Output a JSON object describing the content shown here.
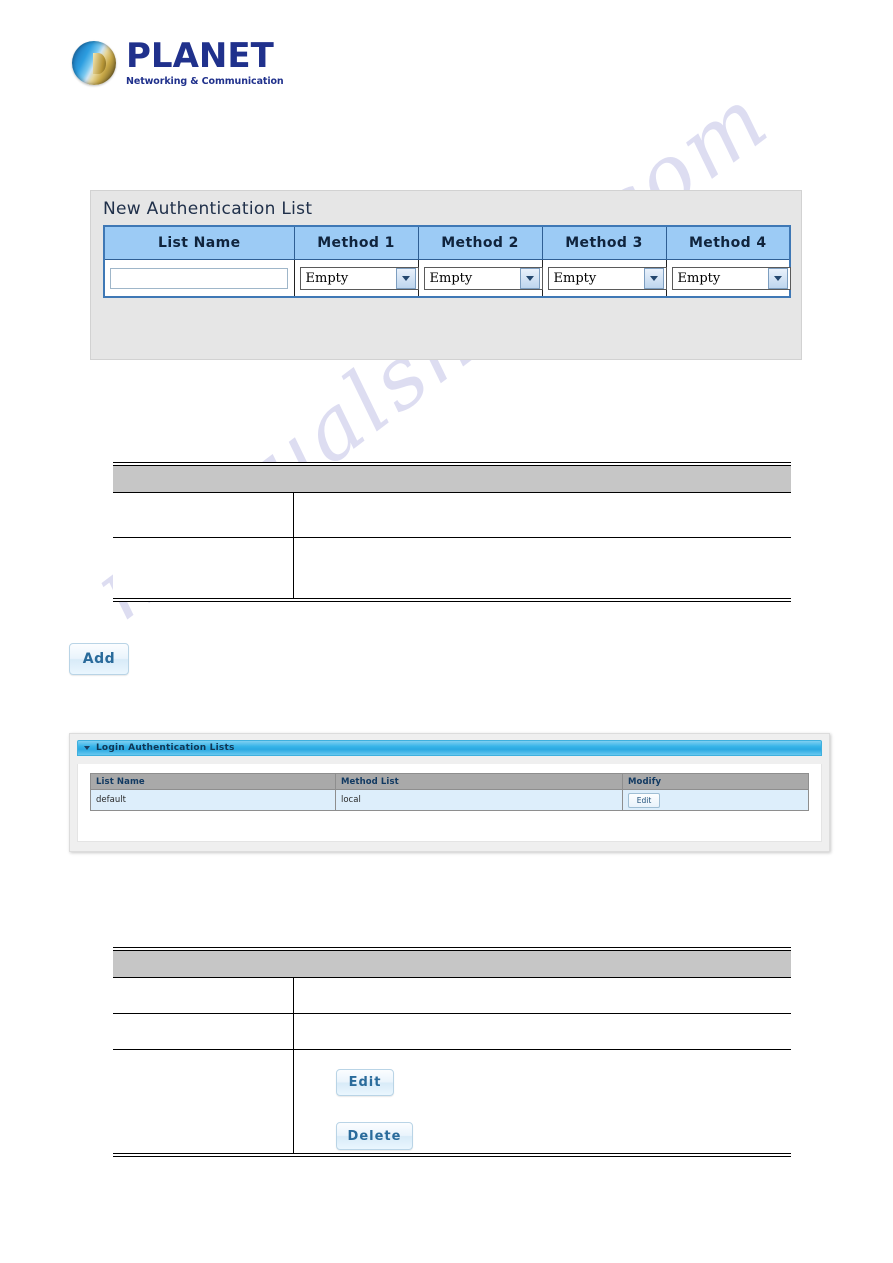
{
  "brand": {
    "name": "PLANET",
    "tagline": "Networking & Communication",
    "logo_icon": "planet-globe-icon",
    "name_color": "#20318c"
  },
  "watermark": {
    "text": "manualshive.com",
    "color": "#c9c9ea"
  },
  "new_auth_panel": {
    "title": "New Authentication List",
    "columns": [
      "List Name",
      "Method 1",
      "Method 2",
      "Method 3",
      "Method 4"
    ],
    "header_bg": "#9ccbf5",
    "border_color": "#3f78b5",
    "row": {
      "list_name_value": "",
      "list_name_placeholder": "",
      "method1": "Empty",
      "method2": "Empty",
      "method3": "Empty",
      "method4": "Empty"
    },
    "add_label": "Add",
    "dropdown_icon": "chevron-down-icon"
  },
  "standalone_buttons": {
    "add_label": "Add",
    "edit_label": "Edit",
    "delete_label": "Delete"
  },
  "doc_table_upper": {
    "columns": [
      "",
      ""
    ],
    "rows": [
      [
        "",
        ""
      ],
      [
        "",
        ""
      ]
    ]
  },
  "doc_table_lower": {
    "columns": [
      "",
      ""
    ],
    "rows": [
      [
        "",
        ""
      ],
      [
        "",
        ""
      ],
      [
        "",
        ""
      ]
    ]
  },
  "login_panel": {
    "header_title": "Login Authentication Lists",
    "collapse_icon": "chevron-down-icon",
    "header_bg": "#35b3e8",
    "columns": [
      "List Name",
      "Method List",
      "Modify"
    ],
    "rows": [
      {
        "list_name": "default",
        "method_list": "local",
        "modify_label": "Edit"
      }
    ]
  }
}
